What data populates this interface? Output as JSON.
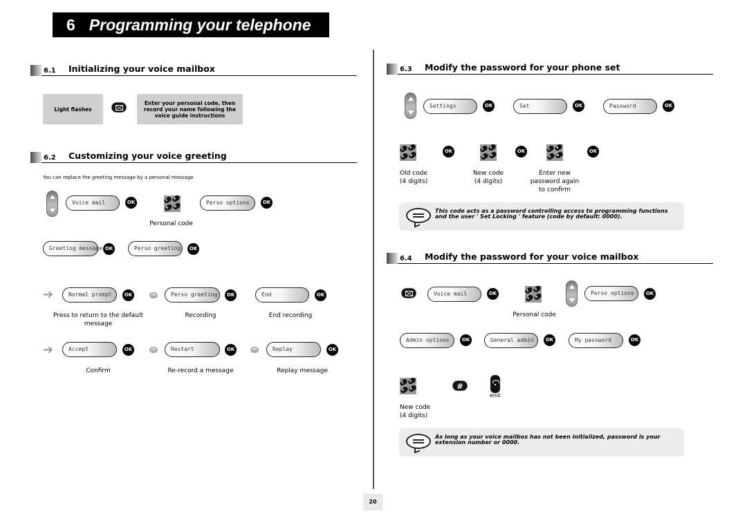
{
  "chapter": {
    "number": "6",
    "title": "Programming your telephone"
  },
  "page_number": "20",
  "sections": {
    "s61": {
      "number": "6.1",
      "title": "Initializing your voice mailbox",
      "box_left": "Light flashes",
      "box_right": "Enter your personal code, then record your name following the voice guide instructions"
    },
    "s62": {
      "number": "6.2",
      "title": "Customizing your voice greeting",
      "intro": "You can replace the greeting message by a personal message.",
      "row1": {
        "lcd1": "Voice mail",
        "lcd2": "Perso options",
        "caption": "Personal code"
      },
      "row2": {
        "lcd1": "Greeting message",
        "lcd2": "Perso greeting"
      },
      "row3": {
        "lcd1": "Normal prompt",
        "lcd2": "Perso greeting",
        "lcd3": "End",
        "cap1": "Press to return to the default message",
        "cap2": "Recording",
        "cap3": "End recording"
      },
      "row4": {
        "lcd1": "Accept",
        "lcd2": "Restart",
        "lcd3": "Replay",
        "cap1": "Confirm",
        "cap2": "Re-record a message",
        "cap3": "Replay message"
      }
    },
    "s63": {
      "number": "6.3",
      "title": "Modify the password for your phone set",
      "lcd1": "Settings",
      "lcd2": "Set",
      "lcd3": "Password",
      "cap1": "Old code\n(4 digits)",
      "cap2": "New code\n(4 digits)",
      "cap3": "Enter new\npassword again\nto confirm",
      "note": "This code acts as a password controlling  access to programming functions and the user ' Set  Locking ' feature  (code by default: 0000)."
    },
    "s64": {
      "number": "6.4",
      "title": "Modify the password for your voice mailbox",
      "lcd1": "Voice mail",
      "lcd2": "Perso options",
      "caption_code": "Personal code",
      "lcd3": "Admin options",
      "lcd4": "General admin",
      "lcd5": "My password",
      "cap_new": "New code\n(4 digits)",
      "end_label": "end",
      "hash_label": "#",
      "note": "As long as your voice mailbox has not been initialized, password is your extension number or 0000."
    }
  },
  "labels": {
    "ok": "OK",
    "or": "OR",
    "arrow": "➔"
  },
  "keypad_keys": [
    "2",
    "3",
    "5",
    "6"
  ]
}
